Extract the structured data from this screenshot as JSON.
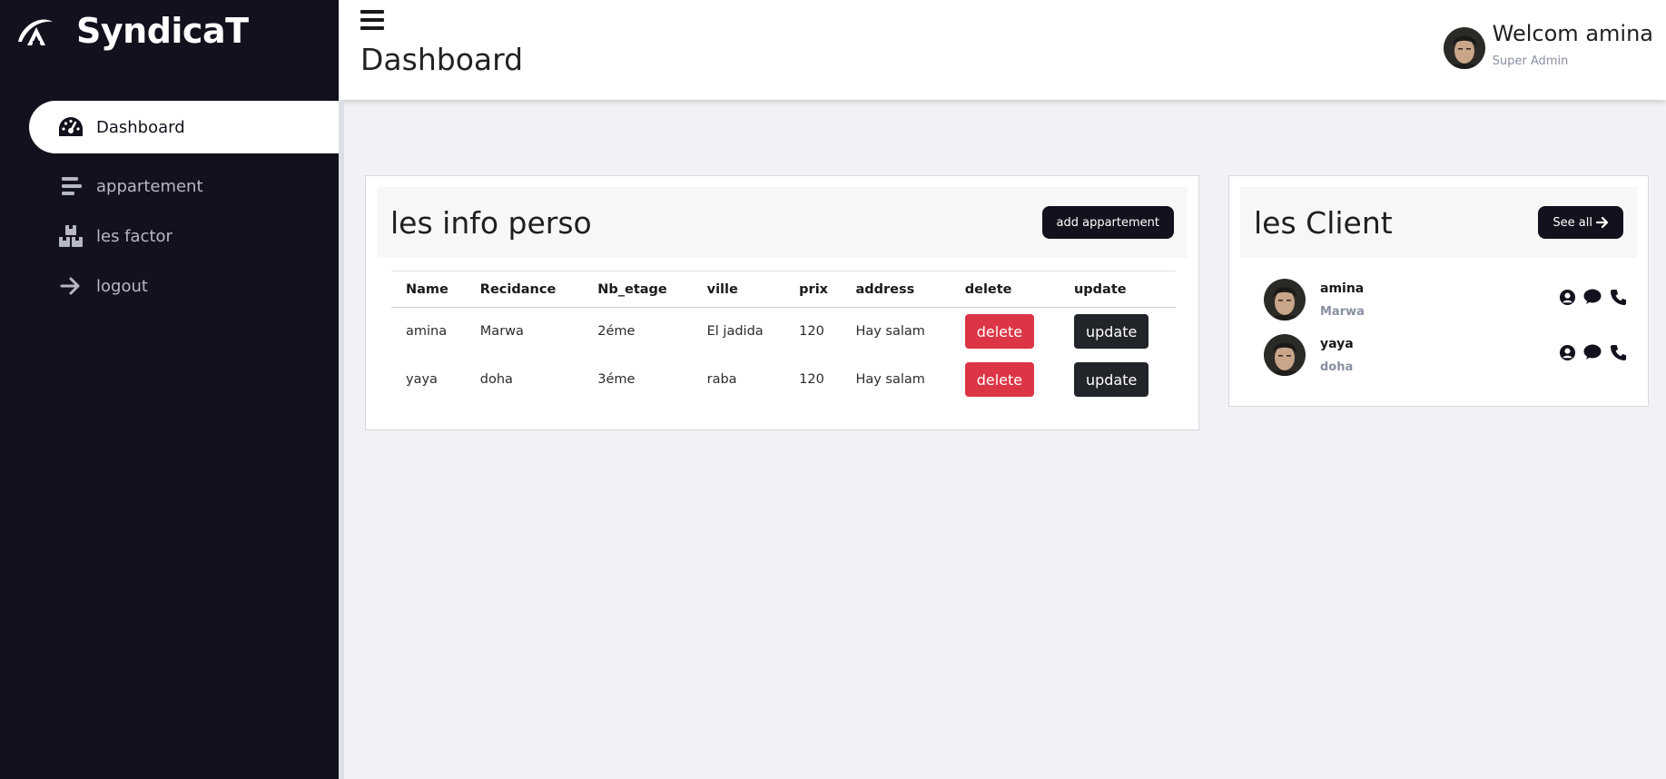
{
  "brand": {
    "name": "SyndicaT"
  },
  "sidebar": {
    "items": [
      {
        "label": "Dashboard",
        "icon": "dashboard-gauge-icon",
        "active": true
      },
      {
        "label": "appartement",
        "icon": "bars-staggered-icon"
      },
      {
        "label": "les factor",
        "icon": "boxes-icon"
      },
      {
        "label": "logout",
        "icon": "arrow-right-icon"
      }
    ]
  },
  "header": {
    "title": "Dashboard",
    "welcome": "Welcom amina",
    "role": "Super Admin"
  },
  "info": {
    "title": "les info perso",
    "add_button": "add appartement",
    "columns": [
      "Name",
      "Recidance",
      "Nb_etage",
      "ville",
      "prix",
      "address",
      "delete",
      "update"
    ],
    "rows": [
      {
        "name": "amina",
        "recidance": "Marwa",
        "nb_etage": "2éme",
        "ville": "El jadida",
        "prix": "120",
        "address": "Hay salam",
        "delete": "delete",
        "update": "update"
      },
      {
        "name": "yaya",
        "recidance": "doha",
        "nb_etage": "3éme",
        "ville": "raba",
        "prix": "120",
        "address": "Hay salam",
        "delete": "delete",
        "update": "update"
      }
    ]
  },
  "clients": {
    "title": "les Client",
    "see_all": "See all",
    "items": [
      {
        "name": "amina",
        "residence": "Marwa"
      },
      {
        "name": "yaya",
        "residence": "doha"
      }
    ]
  },
  "colors": {
    "sidebar_bg": "#11121d",
    "danger": "#dc3545",
    "dark_button": "#212529",
    "page_bg": "#f0f2f5"
  }
}
